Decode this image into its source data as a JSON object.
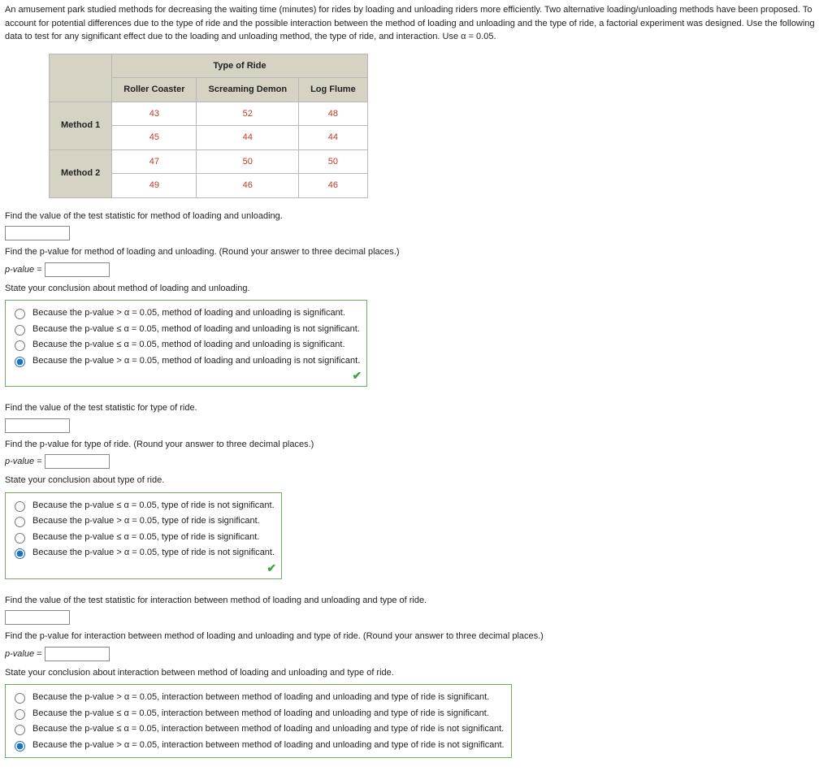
{
  "intro": "An amusement park studied methods for decreasing the waiting time (minutes) for rides by loading and unloading riders more efficiently. Two alternative loading/unloading methods have been proposed. To account for potential differences due to the type of ride and the possible interaction between the method of loading and unloading and the type of ride, a factorial experiment was designed. Use the following data to test for any significant effect due to the loading and unloading method, the type of ride, and interaction. Use α = 0.05.",
  "table": {
    "top_header": "Type of Ride",
    "cols": [
      "Roller Coaster",
      "Screaming Demon",
      "Log Flume"
    ],
    "rows": [
      {
        "label": "Method 1",
        "vals": [
          [
            43,
            52,
            48
          ],
          [
            45,
            44,
            44
          ]
        ]
      },
      {
        "label": "Method 2",
        "vals": [
          [
            47,
            50,
            50
          ],
          [
            49,
            46,
            46
          ]
        ]
      }
    ]
  },
  "section1": {
    "stat_prompt": "Find the value of the test statistic for method of loading and unloading.",
    "pval_prompt": "Find the p-value for method of loading and unloading. (Round your answer to three decimal places.)",
    "pval_label": "p-value =",
    "conclusion_prompt": "State your conclusion about method of loading and unloading.",
    "choices": [
      "Because the p-value > α = 0.05, method of loading and unloading is significant.",
      "Because the p-value ≤ α = 0.05, method of loading and unloading is not significant.",
      "Because the p-value ≤ α = 0.05, method of loading and unloading is significant.",
      "Because the p-value > α = 0.05, method of loading and unloading is not significant."
    ],
    "selected": 3
  },
  "section2": {
    "stat_prompt": "Find the value of the test statistic for type of ride.",
    "pval_prompt": "Find the p-value for type of ride. (Round your answer to three decimal places.)",
    "pval_label": "p-value =",
    "conclusion_prompt": "State your conclusion about type of ride.",
    "choices": [
      "Because the p-value ≤ α = 0.05, type of ride is not significant.",
      "Because the p-value > α = 0.05, type of ride is significant.",
      "Because the p-value ≤ α = 0.05, type of ride is significant.",
      "Because the p-value > α = 0.05, type of ride is not significant."
    ],
    "selected": 3
  },
  "section3": {
    "stat_prompt": "Find the value of the test statistic for interaction between method of loading and unloading and type of ride.",
    "pval_prompt": "Find the p-value for interaction between method of loading and unloading and type of ride. (Round your answer to three decimal places.)",
    "pval_label": "p-value =",
    "conclusion_prompt": "State your conclusion about interaction between method of loading and unloading and type of ride.",
    "choices": [
      "Because the p-value > α = 0.05, interaction between method of loading and unloading and type of ride is significant.",
      "Because the p-value ≤ α = 0.05, interaction between method of loading and unloading and type of ride is significant.",
      "Because the p-value ≤ α = 0.05, interaction between method of loading and unloading and type of ride is not significant.",
      "Because the p-value > α = 0.05, interaction between method of loading and unloading and type of ride is not significant."
    ],
    "selected": 3
  },
  "check": "✔"
}
